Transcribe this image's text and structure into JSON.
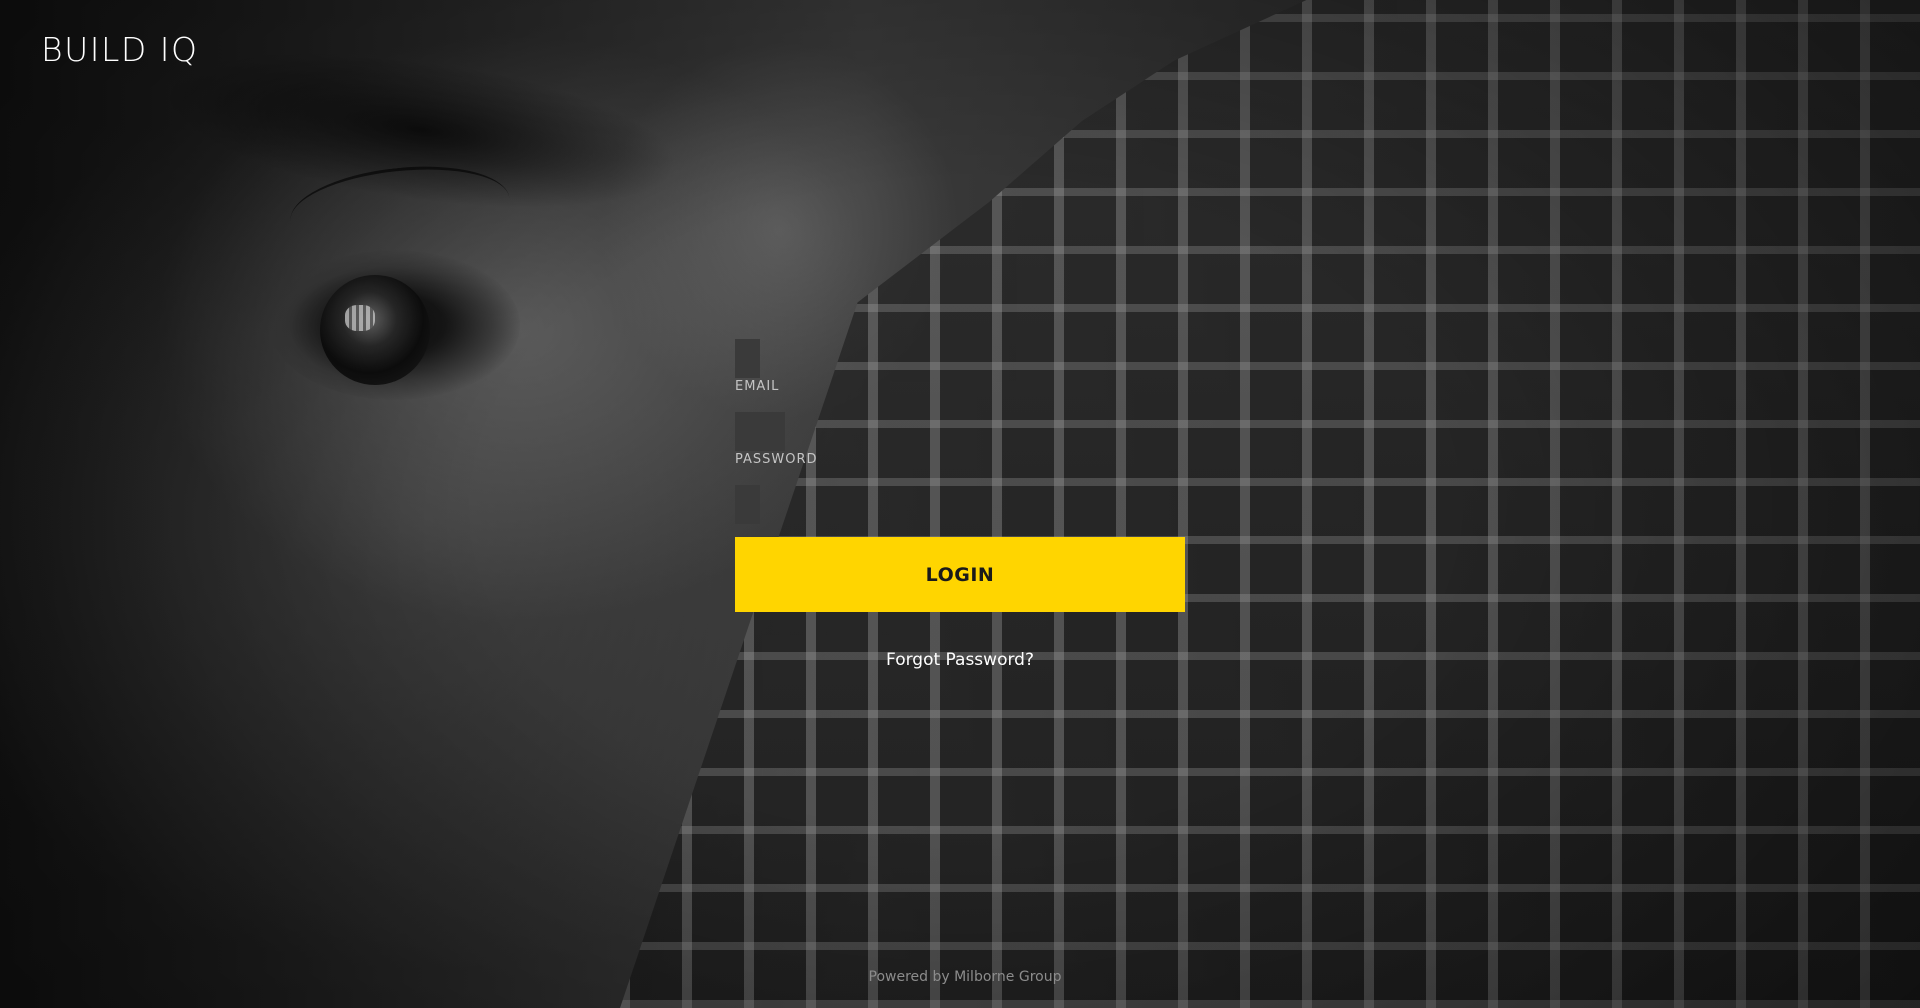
{
  "brand": {
    "logo_text": "BUILD IQ"
  },
  "login_form": {
    "email_label": "EMAIL",
    "email_value": "",
    "password_label": "PASSWORD",
    "password_value": "",
    "login_button_label": "LOGIN",
    "forgot_password_label": "Forgot Password?"
  },
  "footer": {
    "powered_by": "Powered by Milborne Group"
  },
  "colors": {
    "accent": "#ffd500",
    "field_background": "#3a3a3a",
    "logo_text": "#ffffff"
  }
}
